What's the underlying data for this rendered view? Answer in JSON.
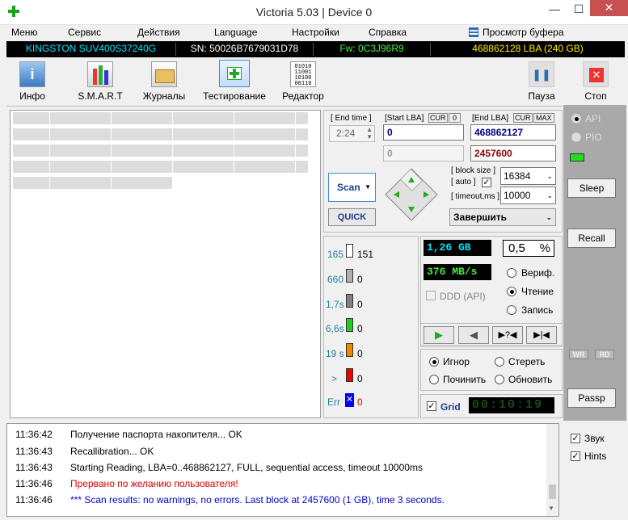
{
  "window": {
    "title": "Victoria 5.03 | Device 0",
    "min": "—",
    "max": "☐",
    "close": "✕"
  },
  "menu": {
    "items": [
      "Меню",
      "Сервис",
      "Действия",
      "Language",
      "Настройки",
      "Справка"
    ],
    "buffer": "Просмотр буфера"
  },
  "info": {
    "model": "KINGSTON SUV400S37240G",
    "sn": "SN: 50026B7679031D78",
    "fw": "Fw: 0C3J96R9",
    "lba": "468862128 LBA (240 GB)"
  },
  "toolbar": {
    "info": "Инфо",
    "smart": "S.M.A.R.T",
    "logs": "Журналы",
    "test": "Тестирование",
    "editor": "Редактор",
    "pause": "Пауза",
    "stop": "Стоп"
  },
  "scan": {
    "end_time_label": "[ End time ]",
    "end_time": "2:24",
    "start_lba_label": "[Start LBA]",
    "cur_label": "CUR",
    "cur_val": "0",
    "end_lba_label": "[End LBA]",
    "max_label": "MAX",
    "start_lba": "0",
    "end_lba": "468862127",
    "current_lba": "0",
    "current_end": "2457600",
    "block_size_label": "[ block size ]",
    "auto_label": "[ auto ]",
    "block_size": "16384",
    "timeout_label": "[ timeout,ms ]",
    "timeout": "10000",
    "scan_button": "Scan",
    "quick_button": "QUICK",
    "finish_select": "Завершить"
  },
  "counters": [
    {
      "label": "165",
      "value": "151",
      "color": "#ffffff"
    },
    {
      "label": "660",
      "value": "0",
      "color": "#b0b0b0"
    },
    {
      "label": "1,7s",
      "value": "0",
      "color": "#808080"
    },
    {
      "label": "6,6s",
      "value": "0",
      "color": "#22cc22"
    },
    {
      "label": "19 s",
      "value": "0",
      "color": "#ee8800"
    },
    {
      "label": ">",
      "value": "0",
      "color": "#ee0000"
    },
    {
      "label": "Err",
      "value": "0"
    }
  ],
  "stats": {
    "size": "1,26 GB",
    "percent": "0,5",
    "percent_unit": "%",
    "speed": "376 MB/s",
    "ddd": "DDD (API)",
    "verify": "Вериф.",
    "read": "Чтение",
    "write": "Запись",
    "ignore": "Игнор",
    "erase": "Стереть",
    "repair": "Починить",
    "refresh": "Обновить",
    "grid_label": "Grid",
    "timer": "00:10:19"
  },
  "sidebar": {
    "api": "API",
    "pio": "PIO",
    "sleep": "Sleep",
    "recall": "Recall",
    "wr": "WR",
    "rd": "RD",
    "passp": "Passp"
  },
  "options": {
    "sound": "Звук",
    "hints": "Hints"
  },
  "log": [
    {
      "time": "11:36:42",
      "msg": "Получение паспорта накопителя... OK",
      "color": "#000000"
    },
    {
      "time": "11:36:43",
      "msg": "Recallibration... OK",
      "color": "#000000"
    },
    {
      "time": "11:36:43",
      "msg": "Starting Reading, LBA=0..468862127, FULL, sequential access, timeout 10000ms",
      "color": "#000000"
    },
    {
      "time": "11:36:46",
      "msg": "Прервано по желанию пользователя!",
      "color": "#dd0000"
    },
    {
      "time": "11:36:46",
      "msg": "*** Scan results: no warnings, no errors. Last block at 2457600 (1 GB), time 3 seconds.",
      "color": "#0000cc"
    }
  ]
}
